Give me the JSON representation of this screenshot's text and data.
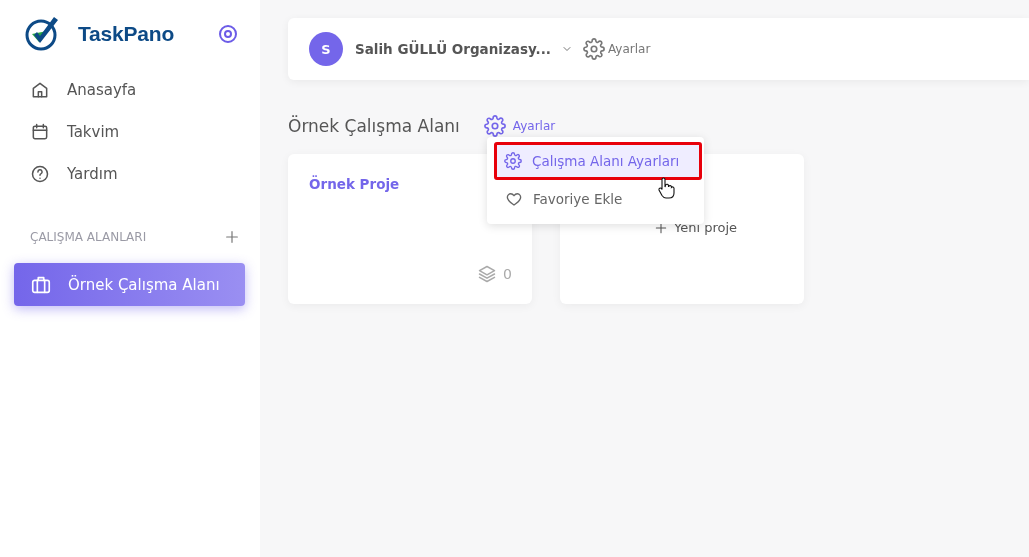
{
  "sidebar": {
    "brand": "TaskPano",
    "nav": [
      {
        "kind": "home",
        "label": "Anasayfa"
      },
      {
        "kind": "calendar",
        "label": "Takvim"
      },
      {
        "kind": "help",
        "label": "Yardım"
      }
    ],
    "section_title": "ÇALIŞMA ALANLARI",
    "workspaces": [
      {
        "label": "Örnek Çalışma Alanı",
        "selected": true
      }
    ]
  },
  "topbar": {
    "avatar": "S",
    "organization": "Salih GÜLLÜ Organizasy...",
    "settings": "Ayarlar"
  },
  "workspace": {
    "title": "Örnek Çalışma Alanı",
    "settings": "Ayarlar"
  },
  "projects": [
    {
      "name": "Örnek Proje",
      "count": "0"
    }
  ],
  "new_project": "Yeni proje",
  "menu": [
    {
      "kind": "settings",
      "label": "Çalışma Alanı Ayarları",
      "selected": true,
      "highlighted": true
    },
    {
      "kind": "favorite",
      "label": "Favoriye Ekle",
      "selected": false,
      "highlighted": false
    }
  ]
}
